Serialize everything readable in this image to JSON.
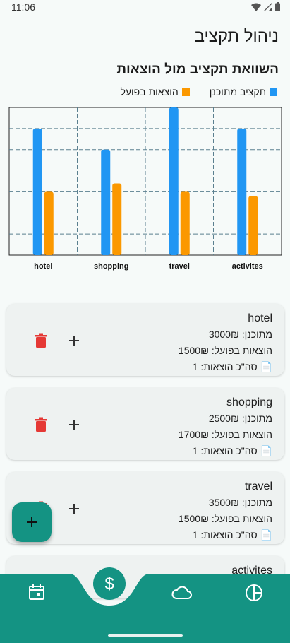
{
  "status_bar": {
    "time": "11:06"
  },
  "app": {
    "title": "ניהול תקציב"
  },
  "chart_section": {
    "title": "השוואת תקציב מול הוצאות",
    "legend": [
      {
        "label": "הוצאות בפועל",
        "color": "#fb9800"
      },
      {
        "label": "תקציב מתוכנן",
        "color": "#2196f3"
      }
    ]
  },
  "chart_data": {
    "type": "bar",
    "categories": [
      "hotel",
      "shopping",
      "travel",
      "activites"
    ],
    "series": [
      {
        "name": "תקציב מתוכנן",
        "color": "#2196f3",
        "values": [
          3000,
          2500,
          3500,
          3000
        ]
      },
      {
        "name": "הוצאות בפועל",
        "color": "#fb9800",
        "values": [
          1500,
          1700,
          1500,
          1400
        ]
      }
    ],
    "ylim": [
      0,
      3500
    ],
    "grid": true,
    "legend_position": "top-right"
  },
  "cards": [
    {
      "name": "hotel",
      "planned": "מתוכנן: 3000₪",
      "actual": "הוצאות בפועל: 1500₪",
      "count": "סה\"כ הוצאות: 1"
    },
    {
      "name": "shopping",
      "planned": "מתוכנן: 2500₪",
      "actual": "הוצאות בפועל: 1700₪",
      "count": "סה\"כ הוצאות: 1"
    },
    {
      "name": "travel",
      "planned": "מתוכנן: 3500₪",
      "actual": "הוצאות בפועל: 1500₪",
      "count": "סה\"כ הוצאות: 1"
    },
    {
      "name": "activites"
    }
  ],
  "colors": {
    "accent": "#149383",
    "delete": "#e53935",
    "nav_bg": "#149383"
  },
  "icons": {
    "delete": "trash-icon",
    "add": "plus-icon",
    "doc": "document-icon",
    "fab": "plus-icon",
    "nav": [
      "calendar-icon",
      "dollar-icon",
      "cloud-icon",
      "pie-chart-icon"
    ]
  }
}
